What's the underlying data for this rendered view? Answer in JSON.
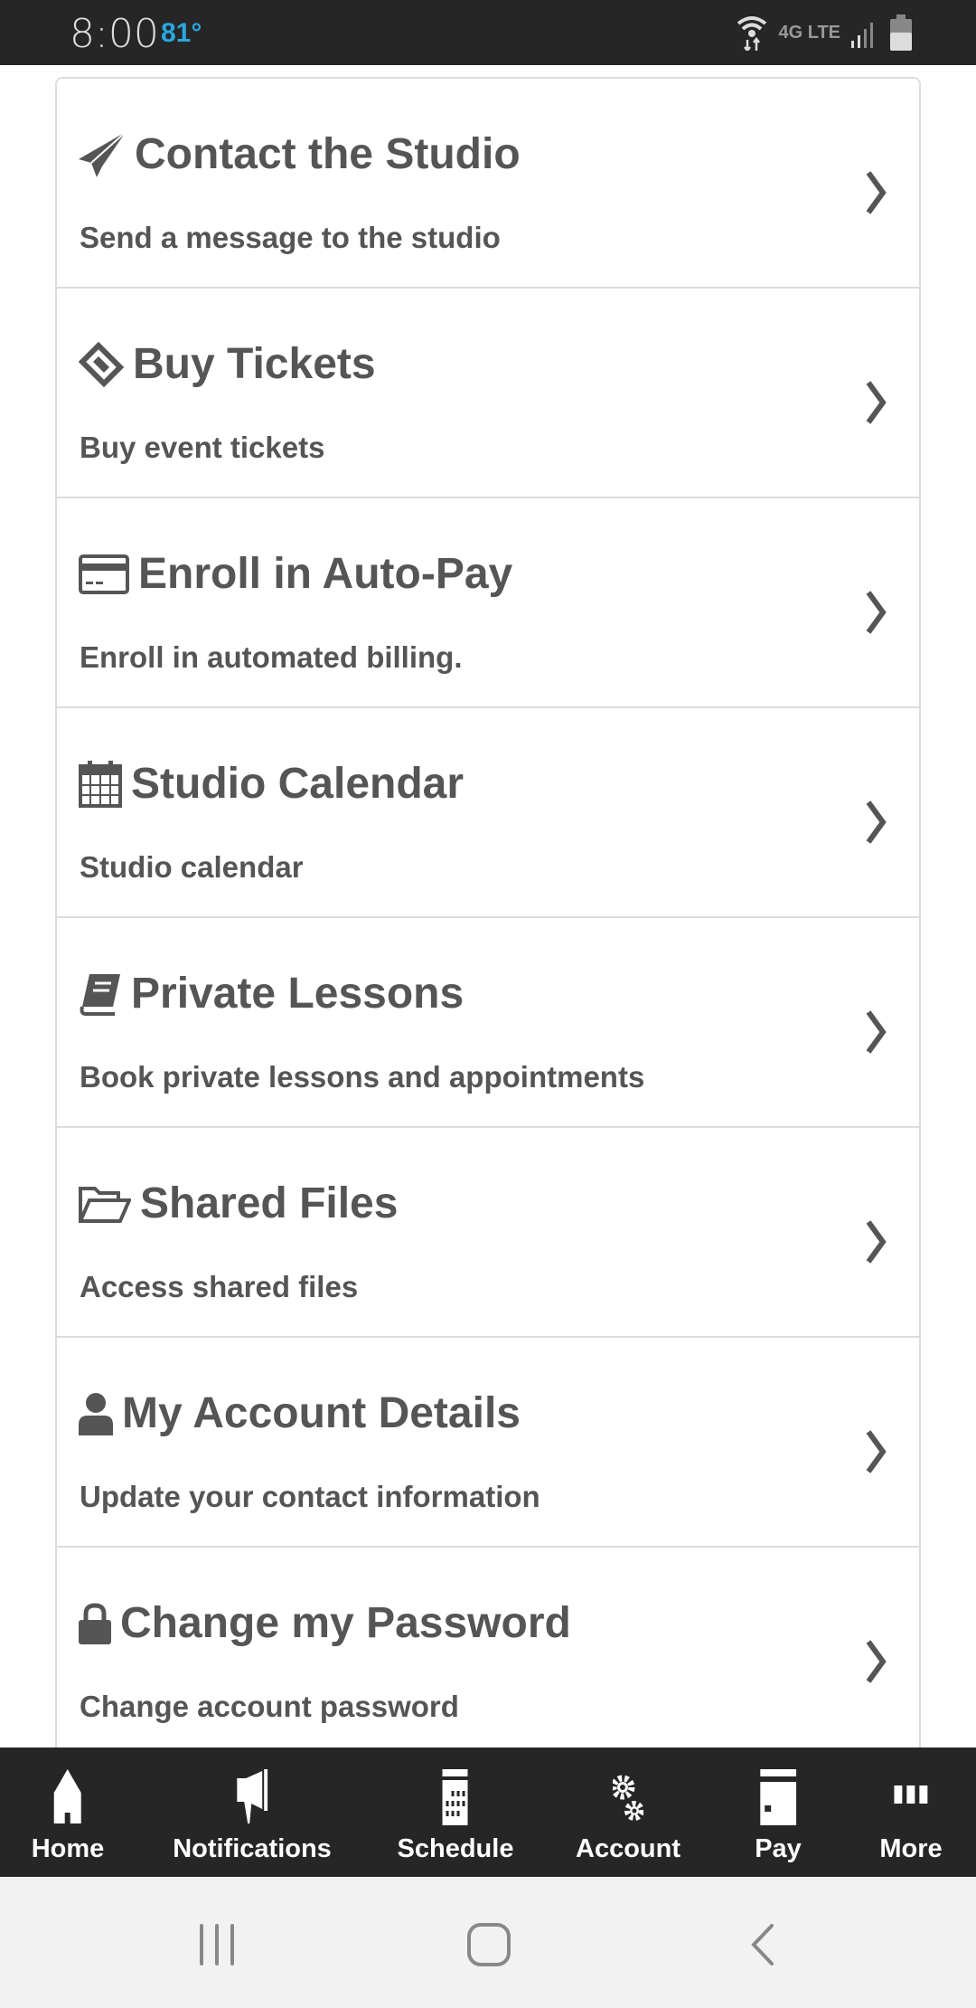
{
  "status_bar": {
    "time": "8:00",
    "temperature": "81°",
    "network": "4G LTE"
  },
  "menu": [
    {
      "icon": "paper-plane-icon",
      "title": "Contact the Studio",
      "subtitle": "Send a message to the studio"
    },
    {
      "icon": "ticket-icon",
      "title": "Buy Tickets",
      "subtitle": "Buy event tickets"
    },
    {
      "icon": "credit-card-icon",
      "title": "Enroll in Auto-Pay",
      "subtitle": "Enroll in automated billing."
    },
    {
      "icon": "calendar-icon",
      "title": "Studio Calendar",
      "subtitle": "Studio calendar"
    },
    {
      "icon": "book-icon",
      "title": "Private Lessons",
      "subtitle": "Book private lessons and appointments"
    },
    {
      "icon": "folder-open-icon",
      "title": "Shared Files",
      "subtitle": "Access shared files"
    },
    {
      "icon": "user-icon",
      "title": "My Account Details",
      "subtitle": "Update your contact information"
    },
    {
      "icon": "lock-icon",
      "title": "Change my Password",
      "subtitle": "Change account password"
    }
  ],
  "bottom_nav": [
    {
      "icon": "home-icon",
      "label": "Home"
    },
    {
      "icon": "megaphone-icon",
      "label": "Notifications"
    },
    {
      "icon": "calendar-grid-icon",
      "label": "Schedule"
    },
    {
      "icon": "gears-icon",
      "label": "Account"
    },
    {
      "icon": "credit-card-icon",
      "label": "Pay"
    },
    {
      "icon": "ellipsis-icon",
      "label": "More"
    }
  ],
  "colors": {
    "status_bar": "#262626",
    "temperature": "#29a8e0",
    "text": "#555555",
    "nav_bg": "#262626",
    "system_nav_bg": "#f2f2f2"
  }
}
